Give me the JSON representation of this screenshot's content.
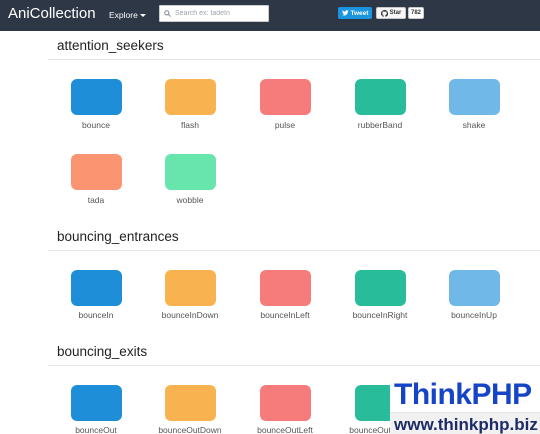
{
  "navbar": {
    "brand": "AniCollection",
    "explore_label": "Explore",
    "search_placeholder": "Search ex: fadeIn",
    "tweet_label": "Tweet",
    "star_label": "Star",
    "star_count": "782"
  },
  "sections": [
    {
      "title": "attention_seekers",
      "items": [
        {
          "label": "bounce",
          "color": "#1f8ed8"
        },
        {
          "label": "flash",
          "color": "#f8b24f"
        },
        {
          "label": "pulse",
          "color": "#f67c7c"
        },
        {
          "label": "rubberBand",
          "color": "#29bc9b"
        },
        {
          "label": "shake",
          "color": "#6fb8e8"
        },
        {
          "label": "tada",
          "color": "#fb9470"
        },
        {
          "label": "wobble",
          "color": "#67e5ac"
        }
      ]
    },
    {
      "title": "bouncing_entrances",
      "items": [
        {
          "label": "bounceIn",
          "color": "#1f8ed8"
        },
        {
          "label": "bounceInDown",
          "color": "#f8b24f"
        },
        {
          "label": "bounceInLeft",
          "color": "#f67c7c"
        },
        {
          "label": "bounceInRight",
          "color": "#29bc9b"
        },
        {
          "label": "bounceInUp",
          "color": "#6fb8e8"
        }
      ]
    },
    {
      "title": "bouncing_exits",
      "items": [
        {
          "label": "bounceOut",
          "color": "#1f8ed8"
        },
        {
          "label": "bounceOutDown",
          "color": "#f8b24f"
        },
        {
          "label": "bounceOutLeft",
          "color": "#f67c7c"
        },
        {
          "label": "bounceOutRight",
          "color": "#29bc9b"
        }
      ]
    }
  ],
  "watermark": {
    "logo_text": "ThinkPHP",
    "url_text": "www.thinkphp.biz"
  },
  "colors": {
    "navbar_bg": "#2e3745",
    "brand_text": "#ffffff",
    "tweet_bg": "#1b95e0"
  },
  "icons": {
    "search": "search-icon",
    "twitter": "twitter-icon",
    "github": "github-icon",
    "dropdown": "chevron-down-icon"
  }
}
